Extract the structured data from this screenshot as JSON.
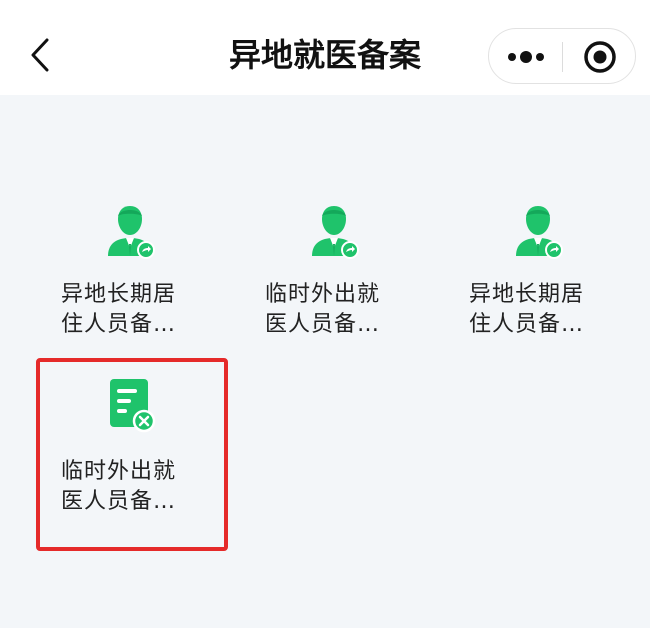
{
  "header": {
    "title": "异地就医备案",
    "back_icon": "chevron-left-icon",
    "more_icon": "more-dots-icon",
    "close_icon": "target-close-icon"
  },
  "menu_items": [
    {
      "label": "异地长期居\n住人员备…",
      "icon": "person-forward-icon",
      "color": "#1fc36b"
    },
    {
      "label": "临时外出就\n医人员备…",
      "icon": "person-forward-icon",
      "color": "#1fc36b"
    },
    {
      "label": "异地长期居\n住人员备…",
      "icon": "person-forward-icon",
      "color": "#1fc36b"
    },
    {
      "label": "临时外出就\n医人员备…",
      "icon": "document-cancel-icon",
      "color": "#1fc36b"
    }
  ],
  "colors": {
    "accent": "#1fc36b",
    "highlight_border": "#e52a2a",
    "background": "#f3f6f9"
  }
}
